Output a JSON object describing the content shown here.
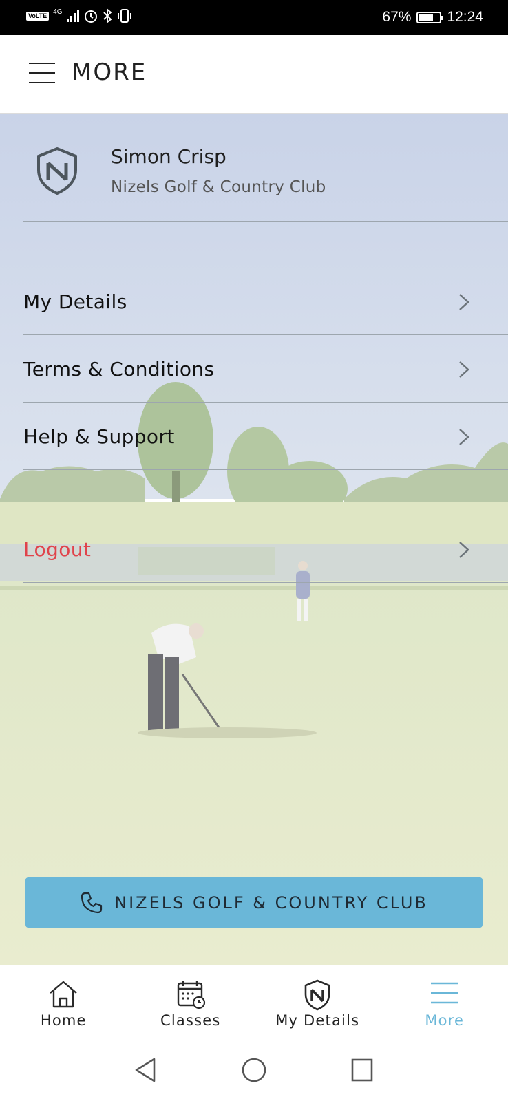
{
  "status_bar": {
    "network": "4G",
    "volte": "VoLTE",
    "battery": "67%",
    "time": "12:24",
    "battery_level": 0.67
  },
  "header": {
    "title": "MORE"
  },
  "profile": {
    "name": "Simon Crisp",
    "club": "Nizels Golf & Country Club"
  },
  "menu": {
    "items": [
      {
        "label": "My Details"
      },
      {
        "label": "Terms & Conditions"
      },
      {
        "label": "Help & Support"
      },
      {
        "label": "Logout"
      }
    ]
  },
  "call_button": {
    "label": "NIZELS GOLF & COUNTRY CLUB"
  },
  "bottom_nav": {
    "items": [
      {
        "label": "Home",
        "icon": "home-icon"
      },
      {
        "label": "Classes",
        "icon": "calendar-clock-icon"
      },
      {
        "label": "My Details",
        "icon": "club-shield-icon"
      },
      {
        "label": "More",
        "icon": "menu-icon",
        "active": true
      }
    ]
  },
  "colors": {
    "accent": "#6ab7d8",
    "logout": "#e0434b",
    "background_overlay": "#f2f2ea"
  }
}
